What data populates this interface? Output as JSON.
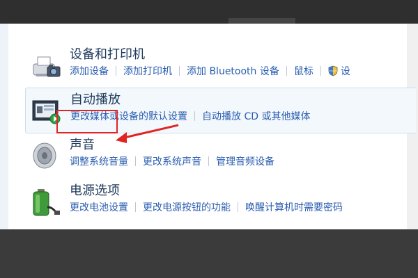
{
  "categories": [
    {
      "title": "设备和打印机",
      "icon": "printer-camera-icon",
      "links": [
        "添加设备",
        "添加打印机",
        "添加 Bluetooth 设备",
        "鼠标",
        "设"
      ]
    },
    {
      "title": "自动播放",
      "icon": "autoplay-icon",
      "links": [
        "更改媒体或设备的默认设置",
        "自动播放 CD 或其他媒体"
      ]
    },
    {
      "title": "声音",
      "icon": "speaker-icon",
      "links": [
        "调整系统音量",
        "更改系统声音",
        "管理音频设备"
      ]
    },
    {
      "title": "电源选项",
      "icon": "battery-icon",
      "links": [
        "更改电池设置",
        "更改电源按钮的功能",
        "唤醒计算机时需要密码"
      ]
    }
  ],
  "annotation": {
    "highlight_color": "#e02424",
    "target": "声音"
  },
  "colors": {
    "title": "#1e395b",
    "link": "#2a5db0",
    "selected_bg": "#f3f8fd"
  }
}
